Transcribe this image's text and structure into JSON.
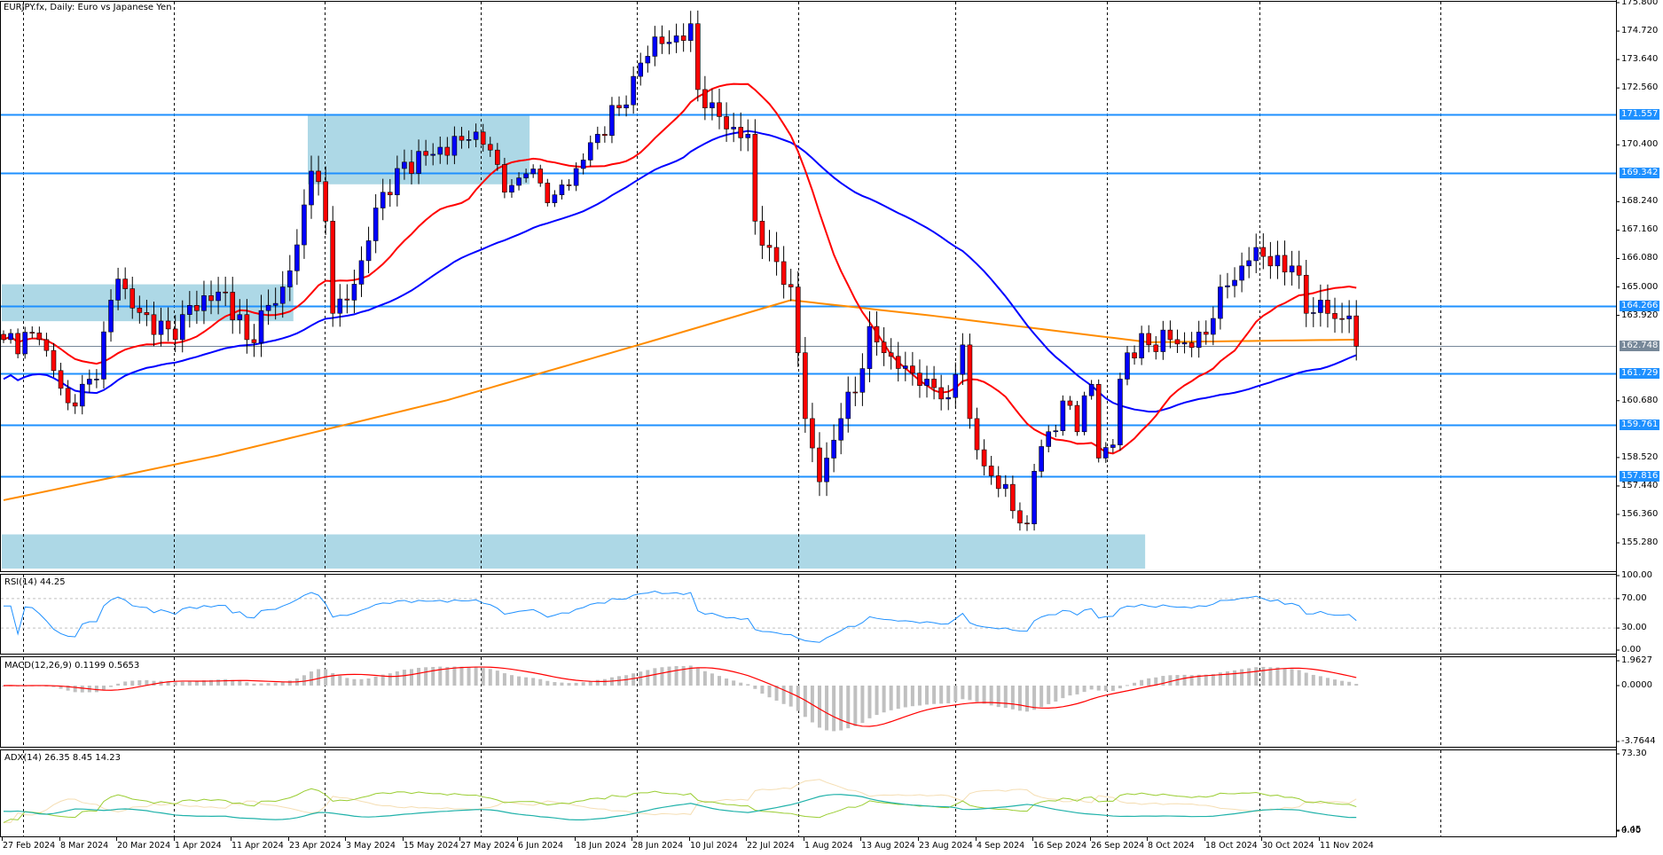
{
  "header": {
    "title": "EURJPY.fx, Daily:  Euro vs Japanese Yen"
  },
  "indicators": {
    "rsi_label": "RSI(14) 44.25",
    "macd_label": "MACD(12,26,9) 0.1199 0.5653",
    "adx_label": "ADX(14) 26.35 8.45 14.23"
  },
  "colors": {
    "bull": "#0000ff",
    "bear": "#ff0000",
    "ma_fast": "#ff0000",
    "ma_slow": "#0000ff",
    "ma_long": "#ff8c00",
    "level": "#1e90ff",
    "zone": "#add8e6",
    "rsi": "#1e90ff",
    "macd_hist": "#c0c0c0",
    "macd_signal": "#ff0000",
    "adx": "#20b2aa",
    "plus_di": "#9acd32",
    "minus_di": "#f5deb3"
  },
  "chart_data": {
    "type": "candlestick",
    "symbol": "EURJPY.fx",
    "timeframe": "Daily",
    "bars": 190,
    "close_keypoints": [
      [
        0,
        163.0
      ],
      [
        5,
        163.0
      ],
      [
        9,
        160.6
      ],
      [
        13,
        161.5
      ],
      [
        15,
        164.5
      ],
      [
        16,
        165.3
      ],
      [
        18,
        164.2
      ],
      [
        24,
        163.0
      ],
      [
        26,
        164.3
      ],
      [
        31,
        164.8
      ],
      [
        34,
        163.0
      ],
      [
        39,
        165.0
      ],
      [
        41,
        166.6
      ],
      [
        43,
        169.4
      ],
      [
        44,
        169.0
      ],
      [
        45,
        167.5
      ],
      [
        46,
        164.0
      ],
      [
        48,
        164.5
      ],
      [
        50,
        166.0
      ],
      [
        52,
        168.0
      ],
      [
        55,
        169.5
      ],
      [
        59,
        170.0
      ],
      [
        65,
        170.6
      ],
      [
        68,
        170.2
      ],
      [
        70,
        168.6
      ],
      [
        73,
        169.3
      ],
      [
        77,
        168.5
      ],
      [
        80,
        169.5
      ],
      [
        83,
        170.8
      ],
      [
        86,
        171.8
      ],
      [
        88,
        173.0
      ],
      [
        91,
        174.5
      ],
      [
        93,
        174.3
      ],
      [
        96,
        175.0
      ],
      [
        97,
        172.5
      ],
      [
        99,
        172.0
      ],
      [
        101,
        171.0
      ],
      [
        104,
        170.8
      ],
      [
        105,
        167.5
      ],
      [
        107,
        166.5
      ],
      [
        110,
        165.0
      ],
      [
        111,
        162.5
      ],
      [
        112,
        160.0
      ],
      [
        114,
        157.6
      ],
      [
        115,
        158.5
      ],
      [
        117,
        160.0
      ],
      [
        119,
        161.0
      ],
      [
        121,
        163.5
      ],
      [
        123,
        162.5
      ],
      [
        126,
        162.0
      ],
      [
        129,
        161.5
      ],
      [
        132,
        160.8
      ],
      [
        134,
        162.8
      ],
      [
        135,
        160.0
      ],
      [
        137,
        158.2
      ],
      [
        140,
        157.5
      ],
      [
        141,
        156.5
      ],
      [
        143,
        156.0
      ],
      [
        144,
        158.0
      ],
      [
        146,
        159.5
      ],
      [
        149,
        160.5
      ],
      [
        150,
        159.5
      ],
      [
        152,
        161.3
      ],
      [
        153,
        158.5
      ],
      [
        155,
        159.0
      ],
      [
        156,
        161.5
      ],
      [
        157,
        162.5
      ],
      [
        160,
        162.8
      ],
      [
        163,
        163.0
      ],
      [
        166,
        162.7
      ],
      [
        168,
        163.2
      ],
      [
        170,
        165.0
      ],
      [
        173,
        165.8
      ],
      [
        175,
        166.5
      ],
      [
        177,
        165.8
      ],
      [
        180,
        165.8
      ],
      [
        182,
        164.0
      ],
      [
        184,
        164.5
      ],
      [
        186,
        163.8
      ],
      [
        188,
        163.9
      ],
      [
        189,
        162.748
      ]
    ],
    "ma_long_keypoints": [
      [
        0,
        156.9
      ],
      [
        30,
        158.6
      ],
      [
        62,
        160.7
      ],
      [
        90,
        162.9
      ],
      [
        110,
        164.5
      ],
      [
        130,
        163.9
      ],
      [
        160,
        162.9
      ],
      [
        189,
        163.0
      ]
    ],
    "y_axis": {
      "min": 154.3,
      "max": 175.8,
      "ticks": [
        "175.800",
        "174.720",
        "173.640",
        "172.560",
        "170.400",
        "168.240",
        "167.160",
        "166.080",
        "165.000",
        "163.920",
        "160.680",
        "158.520",
        "157.440",
        "156.360",
        "155.280"
      ]
    },
    "levels": [
      {
        "price": 171.557,
        "label": "171.557",
        "kind": "resistance"
      },
      {
        "price": 169.342,
        "label": "169.342",
        "kind": "resistance"
      },
      {
        "price": 164.266,
        "label": "164.266",
        "kind": "resistance"
      },
      {
        "price": 161.729,
        "label": "161.729",
        "kind": "support"
      },
      {
        "price": 159.761,
        "label": "159.761",
        "kind": "support"
      },
      {
        "price": 157.816,
        "label": "157.816",
        "kind": "support"
      }
    ],
    "current_price": {
      "price": 162.748,
      "label": "162.748"
    },
    "zones": [
      {
        "from_bar": 43,
        "to_bar": 73,
        "top": 171.557,
        "bottom": 168.9
      },
      {
        "from_bar": 0,
        "to_bar": 40,
        "top": 165.1,
        "bottom": 163.7
      },
      {
        "from_bar": 0,
        "to_bar": 159,
        "top": 155.6,
        "bottom": 154.3
      }
    ],
    "x_labels": [
      "27 Feb 2024",
      "8 Mar 2024",
      "20 Mar 2024",
      "1 Apr 2024",
      "11 Apr 2024",
      "23 Apr 2024",
      "3 May 2024",
      "15 May 2024",
      "27 May 2024",
      "6 Jun 2024",
      "18 Jun 2024",
      "28 Jun 2024",
      "10 Jul 2024",
      "22 Jul 2024",
      "1 Aug 2024",
      "13 Aug 2024",
      "23 Aug 2024",
      "4 Sep 2024",
      "16 Sep 2024",
      "26 Sep 2024",
      "8 Oct 2024",
      "18 Oct 2024",
      "30 Oct 2024",
      "11 Nov 2024"
    ],
    "rsi_axis": [
      "100.00",
      "70.00",
      "30.00",
      "0.00"
    ],
    "macd_axis": [
      "1.9627",
      "0.0000",
      "-3.7644"
    ],
    "adx_axis": [
      "73.30",
      "4.45",
      "0.00"
    ]
  }
}
